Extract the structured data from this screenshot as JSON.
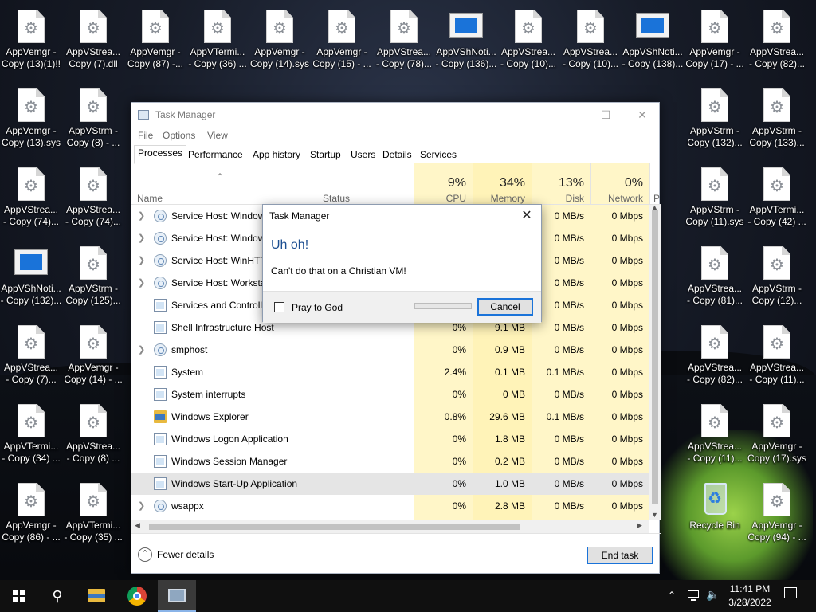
{
  "desktop_icons": [
    {
      "label1": "AppVemgr -",
      "label2": "Copy (13)(1)!!",
      "type": "doc"
    },
    {
      "label1": "AppVStrea...",
      "label2": "Copy (7).dll",
      "type": "doc"
    },
    {
      "label1": "AppVemgr -",
      "label2": "Copy (87) -...",
      "type": "doc"
    },
    {
      "label1": "AppVTermi...",
      "label2": "- Copy (36) ...",
      "type": "doc"
    },
    {
      "label1": "AppVemgr -",
      "label2": "Copy (14).sys",
      "type": "doc"
    },
    {
      "label1": "AppVemgr -",
      "label2": "Copy (15) - ...",
      "type": "doc"
    },
    {
      "label1": "AppVStrea...",
      "label2": "- Copy (78)...",
      "type": "doc"
    },
    {
      "label1": "AppVShNoti...",
      "label2": "- Copy (136)...",
      "type": "win"
    },
    {
      "label1": "AppVStrea...",
      "label2": "- Copy (10)...",
      "type": "doc"
    },
    {
      "label1": "AppVStrea...",
      "label2": "- Copy (10)...",
      "type": "doc"
    },
    {
      "label1": "AppVShNoti...",
      "label2": "- Copy (138)...",
      "type": "win"
    },
    {
      "label1": "AppVemgr -",
      "label2": "Copy (17) - ...",
      "type": "doc"
    },
    {
      "label1": "AppVStrea...",
      "label2": "- Copy (82)...",
      "type": "doc"
    },
    {
      "label1": "AppVemgr -",
      "label2": "Copy (13).sys",
      "type": "doc"
    },
    {
      "label1": "AppVStrm -",
      "label2": "Copy (8) - ...",
      "type": "doc"
    },
    {
      "label1": "AppVStrm -",
      "label2": "Copy (132)...",
      "type": "doc"
    },
    {
      "label1": "AppVStrm -",
      "label2": "Copy (133)...",
      "type": "doc"
    },
    {
      "label1": "AppVStrea...",
      "label2": "- Copy (74)...",
      "type": "doc"
    },
    {
      "label1": "AppVStrea...",
      "label2": "- Copy (74)...",
      "type": "doc"
    },
    {
      "label1": "AppVStrm -",
      "label2": "Copy (11).sys",
      "type": "doc"
    },
    {
      "label1": "AppVTermi...",
      "label2": "- Copy (42) ...",
      "type": "doc"
    },
    {
      "label1": "AppVShNoti...",
      "label2": "- Copy (132)...",
      "type": "win"
    },
    {
      "label1": "AppVStrm -",
      "label2": "Copy (125)...",
      "type": "doc"
    },
    {
      "label1": "AppVStrea...",
      "label2": "- Copy (81)...",
      "type": "doc"
    },
    {
      "label1": "AppVStrm -",
      "label2": "Copy (12)...",
      "type": "doc"
    },
    {
      "label1": "AppVStrea...",
      "label2": "- Copy (7)...",
      "type": "doc"
    },
    {
      "label1": "AppVemgr -",
      "label2": "Copy (14) - ...",
      "type": "doc"
    },
    {
      "label1": "AppVStrea...",
      "label2": "- Copy (82)...",
      "type": "doc"
    },
    {
      "label1": "AppVStrea...",
      "label2": "- Copy (11)...",
      "type": "doc"
    },
    {
      "label1": "AppVTermi...",
      "label2": "- Copy (34) ...",
      "type": "doc"
    },
    {
      "label1": "AppVStrea...",
      "label2": "- Copy (8) ...",
      "type": "doc"
    },
    {
      "label1": "AppVStrea...",
      "label2": "- Copy (11)...",
      "type": "doc"
    },
    {
      "label1": "AppVemgr -",
      "label2": "Copy (17).sys",
      "type": "doc"
    },
    {
      "label1": "AppVemgr -",
      "label2": "Copy (86) - ...",
      "type": "doc"
    },
    {
      "label1": "AppVTermi...",
      "label2": "- Copy (35) ...",
      "type": "doc"
    },
    {
      "label1": "Recycle Bin",
      "label2": "",
      "type": "recycle"
    },
    {
      "label1": "AppVemgr -",
      "label2": "Copy (94) - ...",
      "type": "doc"
    }
  ],
  "task_manager": {
    "title": "Task Manager",
    "menu": [
      "File",
      "Options",
      "View"
    ],
    "tabs": [
      "Processes",
      "Performance",
      "App history",
      "Startup",
      "Users",
      "Details",
      "Services"
    ],
    "active_tab": "Processes",
    "columns": {
      "name": "Name",
      "status": "Status",
      "cpu": {
        "pct": "9%",
        "label": "CPU"
      },
      "memory": {
        "pct": "34%",
        "label": "Memory"
      },
      "disk": {
        "pct": "13%",
        "label": "Disk"
      },
      "network": {
        "pct": "0%",
        "label": "Network"
      },
      "extra": "P"
    },
    "processes": [
      {
        "name": "Service Host: Window",
        "expand": true,
        "icon": "gear",
        "cpu": "",
        "mem": "",
        "disk": "0 MB/s",
        "net": "0 Mbps"
      },
      {
        "name": "Service Host: Window",
        "expand": true,
        "icon": "gear",
        "cpu": "",
        "mem": "",
        "disk": "0 MB/s",
        "net": "0 Mbps"
      },
      {
        "name": "Service Host: WinHTT",
        "expand": true,
        "icon": "gear",
        "cpu": "",
        "mem": "",
        "disk": "0 MB/s",
        "net": "0 Mbps"
      },
      {
        "name": "Service Host: Worksta",
        "expand": true,
        "icon": "gear",
        "cpu": "",
        "mem": "",
        "disk": "0 MB/s",
        "net": "0 Mbps"
      },
      {
        "name": "Services and Controlle",
        "expand": false,
        "icon": "winapp",
        "cpu": "",
        "mem": "",
        "disk": "0 MB/s",
        "net": "0 Mbps"
      },
      {
        "name": "Shell Infrastructure Host",
        "expand": false,
        "icon": "winapp",
        "cpu": "0%",
        "mem": "9.1 MB",
        "disk": "0 MB/s",
        "net": "0 Mbps"
      },
      {
        "name": "smphost",
        "expand": true,
        "icon": "gear",
        "cpu": "0%",
        "mem": "0.9 MB",
        "disk": "0 MB/s",
        "net": "0 Mbps"
      },
      {
        "name": "System",
        "expand": false,
        "icon": "winapp",
        "cpu": "2.4%",
        "mem": "0.1 MB",
        "disk": "0.1 MB/s",
        "net": "0 Mbps"
      },
      {
        "name": "System interrupts",
        "expand": false,
        "icon": "winapp",
        "cpu": "0%",
        "mem": "0 MB",
        "disk": "0 MB/s",
        "net": "0 Mbps"
      },
      {
        "name": "Windows Explorer",
        "expand": false,
        "icon": "folder",
        "cpu": "0.8%",
        "mem": "29.6 MB",
        "disk": "0.1 MB/s",
        "net": "0 Mbps"
      },
      {
        "name": "Windows Logon Application",
        "expand": false,
        "icon": "winapp",
        "cpu": "0%",
        "mem": "1.8 MB",
        "disk": "0 MB/s",
        "net": "0 Mbps"
      },
      {
        "name": "Windows Session Manager",
        "expand": false,
        "icon": "winapp",
        "cpu": "0%",
        "mem": "0.2 MB",
        "disk": "0 MB/s",
        "net": "0 Mbps"
      },
      {
        "name": "Windows Start-Up Application",
        "expand": false,
        "icon": "winapp",
        "cpu": "0%",
        "mem": "1.0 MB",
        "disk": "0 MB/s",
        "net": "0 Mbps",
        "selected": true
      },
      {
        "name": "wsappx",
        "expand": true,
        "icon": "gear",
        "cpu": "0%",
        "mem": "2.8 MB",
        "disk": "0 MB/s",
        "net": "0 Mbps"
      }
    ],
    "fewer_details": "Fewer details",
    "end_task": "End task"
  },
  "dialog": {
    "title": "Task Manager",
    "main": "Uh oh!",
    "message": "Can't do that on a Christian VM!",
    "checkbox_label": "Pray to God",
    "cancel": "Cancel"
  },
  "taskbar": {
    "time": "11:41 PM",
    "date": "3/28/2022"
  }
}
